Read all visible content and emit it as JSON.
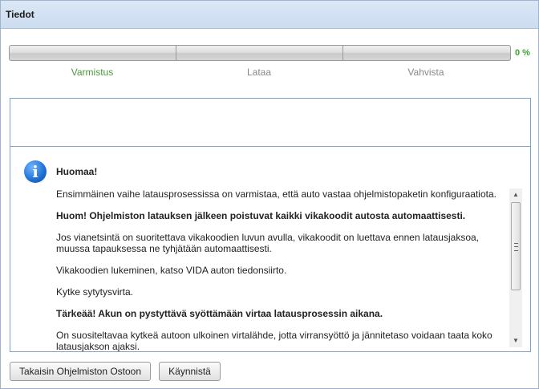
{
  "window": {
    "title": "Tiedot"
  },
  "progress": {
    "percent_label": "0 %",
    "value": 0,
    "steps": [
      {
        "label": "Varmistus",
        "active": true
      },
      {
        "label": "Lataa",
        "active": false
      },
      {
        "label": "Vahvista",
        "active": false
      }
    ]
  },
  "notice": {
    "heading": "Huomaa!",
    "paragraphs": [
      {
        "text": "Ensimmäinen vaihe latausprosessissa on varmistaa, että auto vastaa ohjelmistopaketin konfiguraatiota.",
        "bold": false
      },
      {
        "text": "Huom! Ohjelmiston latauksen jälkeen poistuvat kaikki vikakoodit autosta automaattisesti.",
        "bold": true
      },
      {
        "text": "Jos vianetsintä on suoritettava vikakoodien luvun avulla, vikakoodit on luettava ennen latausjaksoa, muussa tapauksessa ne tyhjätään automaattisesti.",
        "bold": false
      },
      {
        "text": "Vikakoodien lukeminen, katso VIDA auton tiedonsiirto.",
        "bold": false
      },
      {
        "text": "Kytke sytytysvirta.",
        "bold": false
      },
      {
        "text": "Tärkeää! Akun on pystyttävä syöttämään virtaa latausprosessin aikana.",
        "bold": true
      },
      {
        "text": "On suositeltavaa kytkeä autoon ulkoinen virtalähde, jotta virransyöttö ja jännitetaso voidaan taata koko latausjakson ajaksi.",
        "bold": false
      }
    ]
  },
  "buttons": {
    "back": "Takaisin Ohjelmiston Ostoon",
    "start": "Käynnistä"
  },
  "colors": {
    "accent_green": "#3aa52e",
    "header_bg": "#dbe7f6",
    "border_blue": "#7fa2c8",
    "info_blue": "#1e6fd4"
  }
}
